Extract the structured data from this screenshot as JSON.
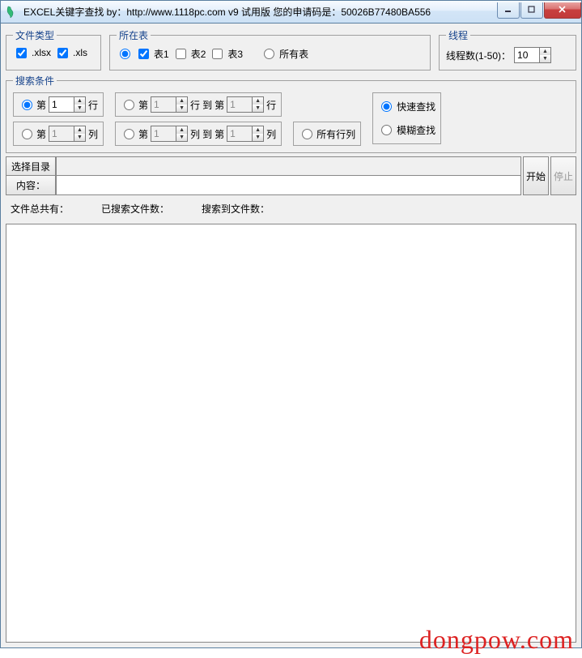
{
  "window": {
    "title": "EXCEL关键字查找  by：http://www.1118pc.com v9 试用版 您的申请码是：50026B77480BA556"
  },
  "fileType": {
    "legend": "文件类型",
    "xlsx": ".xlsx",
    "xls": ".xls"
  },
  "sheet": {
    "legend": "所在表",
    "s1": "表1",
    "s2": "表2",
    "s3": "表3",
    "all": "所有表"
  },
  "thread": {
    "legend": "线程",
    "label": "线程数(1-50)：",
    "value": "10"
  },
  "search": {
    "legend": "搜索条件",
    "di": "第",
    "row": "行",
    "col": "列",
    "to": "到",
    "v1": "1",
    "allRowCol": "所有行列",
    "fast": "快速查找",
    "fuzzy": "模糊查找"
  },
  "dir": {
    "select": "选择目录",
    "start": "开始",
    "stop": "停止",
    "contentLabel": "内容："
  },
  "stats": {
    "total": "文件总共有：",
    "searched": "已搜索文件数：",
    "found": "搜索到文件数："
  },
  "watermark": "dongpow.com"
}
